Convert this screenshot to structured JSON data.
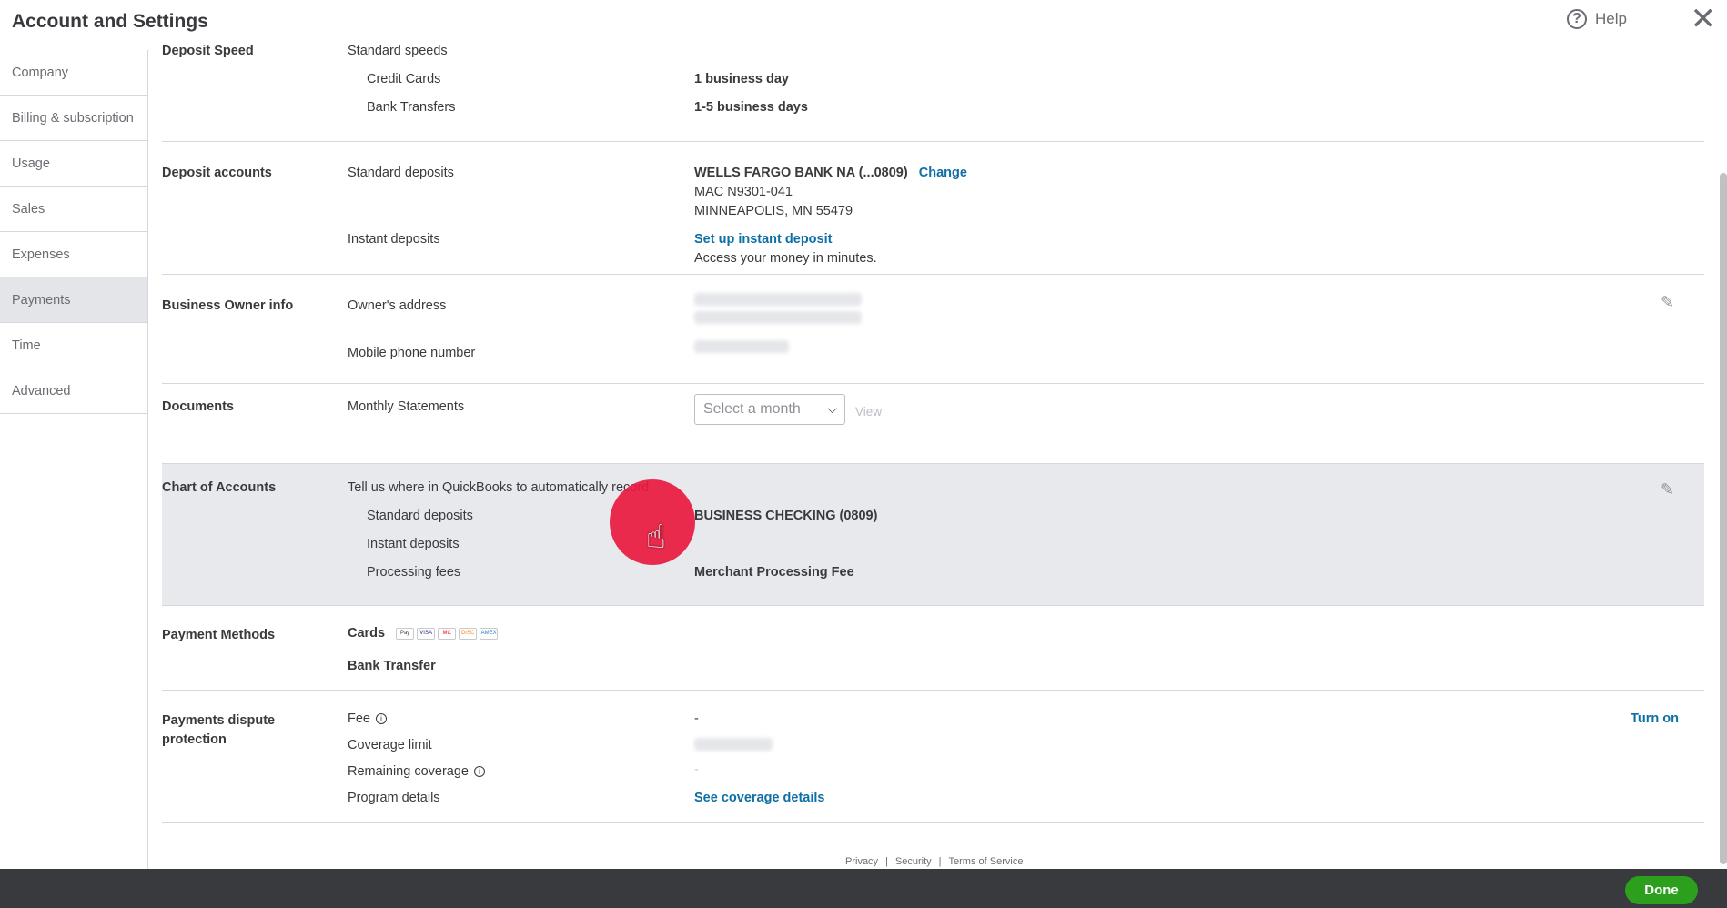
{
  "header": {
    "title": "Account and Settings",
    "help_label": "Help",
    "close_glyph": "✕"
  },
  "sidebar": {
    "items": [
      {
        "label": "Company"
      },
      {
        "label": "Billing & subscription"
      },
      {
        "label": "Usage"
      },
      {
        "label": "Sales"
      },
      {
        "label": "Expenses"
      },
      {
        "label": "Payments",
        "active": true
      },
      {
        "label": "Time"
      },
      {
        "label": "Advanced"
      }
    ]
  },
  "deposit_speed": {
    "heading": "Deposit Speed",
    "label": "Standard speeds",
    "credit_cards": {
      "label": "Credit Cards",
      "value": "1 business day"
    },
    "bank_transfers": {
      "label": "Bank Transfers",
      "value": "1-5 business days"
    }
  },
  "deposit_accounts": {
    "heading": "Deposit accounts",
    "standard_label": "Standard deposits",
    "bank_name": "WELLS FARGO BANK NA (...0809)",
    "change_label": "Change",
    "address_line1": "MAC N9301-041",
    "address_line2": "MINNEAPOLIS, MN 55479",
    "instant_label": "Instant deposits",
    "instant_link": "Set up instant deposit",
    "instant_desc": "Access your money in minutes."
  },
  "business_owner": {
    "heading": "Business Owner info",
    "address_label": "Owner's address",
    "phone_label": "Mobile phone number"
  },
  "documents": {
    "heading": "Documents",
    "label": "Monthly Statements",
    "select_placeholder": "Select a month",
    "view_label": "View"
  },
  "chart_of_accounts": {
    "heading": "Chart of Accounts",
    "intro": "Tell us where in QuickBooks to automatically record.",
    "standard_label": "Standard deposits",
    "standard_value": "BUSINESS CHECKING (0809)",
    "instant_label": "Instant deposits",
    "fees_label": "Processing fees",
    "fees_value": "Merchant Processing Fee"
  },
  "payment_methods": {
    "heading": "Payment Methods",
    "cards_label": "Cards",
    "card_icons": [
      "Pay",
      "VISA",
      "MC",
      "DISC",
      "AMEX"
    ],
    "bank_label": "Bank Transfer"
  },
  "dispute": {
    "heading_line1": "Payments dispute",
    "heading_line2": "protection",
    "fee_label": "Fee",
    "fee_value": "-",
    "coverage_label": "Coverage limit",
    "remaining_label": "Remaining coverage",
    "remaining_value": "-",
    "program_label": "Program details",
    "program_link": "See coverage details",
    "turn_on": "Turn on"
  },
  "footer": {
    "privacy": "Privacy",
    "security": "Security",
    "terms": "Terms of Service",
    "sep": "|"
  },
  "actions": {
    "done": "Done"
  }
}
